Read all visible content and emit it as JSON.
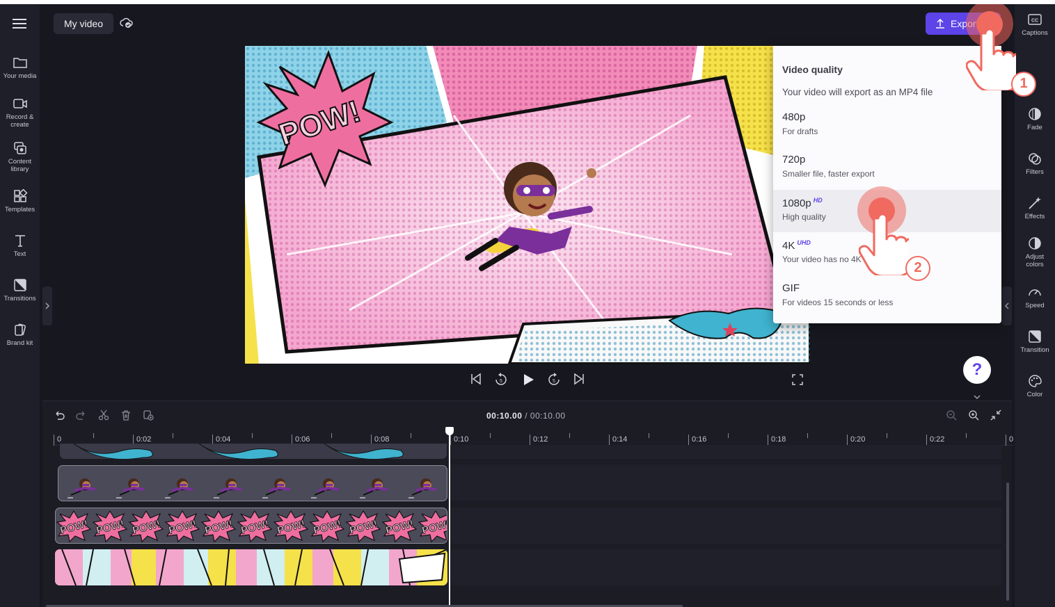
{
  "header": {
    "project_title": "My video",
    "export_label": "Export"
  },
  "left_sidebar": {
    "items": [
      {
        "label": "Your media",
        "icon": "folder-icon"
      },
      {
        "label": "Record &\ncreate",
        "icon": "camera-icon"
      },
      {
        "label": "Content\nlibrary",
        "icon": "library-icon"
      },
      {
        "label": "Templates",
        "icon": "templates-icon"
      },
      {
        "label": "Text",
        "icon": "text-icon"
      },
      {
        "label": "Transitions",
        "icon": "transitions-icon"
      },
      {
        "label": "Brand kit",
        "icon": "brand-kit-icon"
      }
    ]
  },
  "right_sidebar": {
    "items": [
      {
        "label": "Captions",
        "icon": "captions-icon"
      },
      {
        "label": "Fade",
        "icon": "fade-icon"
      },
      {
        "label": "Filters",
        "icon": "filters-icon"
      },
      {
        "label": "Effects",
        "icon": "effects-icon"
      },
      {
        "label": "Adjust\ncolors",
        "icon": "adjust-colors-icon"
      },
      {
        "label": "Speed",
        "icon": "speed-icon"
      },
      {
        "label": "Transition",
        "icon": "transition-icon"
      },
      {
        "label": "Color",
        "icon": "color-icon"
      }
    ]
  },
  "preview": {
    "pow_text": "POW!"
  },
  "export_menu": {
    "title": "Video quality",
    "subtitle": "Your video will export as an MP4 file",
    "options": [
      {
        "name": "480p",
        "badge": "",
        "desc": "For drafts"
      },
      {
        "name": "720p",
        "badge": "",
        "desc": "Smaller file, faster export"
      },
      {
        "name": "1080p",
        "badge": "HD",
        "desc": "High quality",
        "selected": true
      },
      {
        "name": "4K",
        "badge": "UHD",
        "desc": "Your video has no 4K m"
      },
      {
        "name": "GIF",
        "badge": "",
        "desc": "For videos 15 seconds or less"
      }
    ]
  },
  "annotations": {
    "step1": "1",
    "step2": "2"
  },
  "help": {
    "label": "?"
  },
  "timeline": {
    "current_time": "00:10.00",
    "separator": " / ",
    "duration": "00:10.00",
    "ruler_labels": [
      "0",
      "0:02",
      "0:04",
      "0:06",
      "0:08",
      "0:10",
      "0:12",
      "0:14",
      "0:16",
      "0:18",
      "0:20",
      "0:22",
      "0"
    ]
  },
  "colors": {
    "accent": "#5b44e8",
    "background": "#17171f",
    "sidebar": "#1f1f29",
    "highlight": "#f06a60"
  }
}
